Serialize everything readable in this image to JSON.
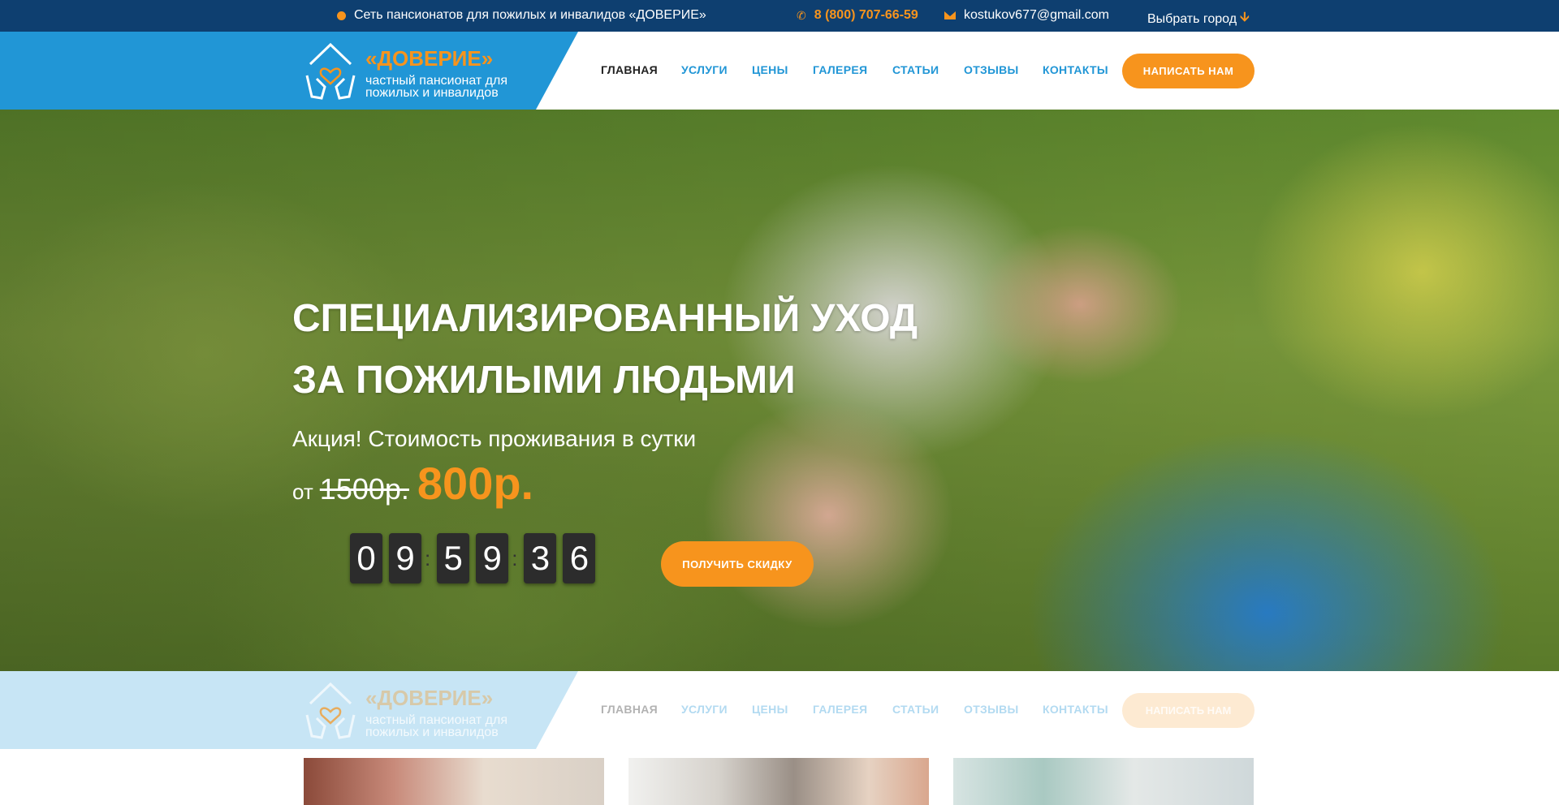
{
  "topbar": {
    "network_text": "Сеть пансионатов для пожилых и инвалидов «ДОВЕРИЕ»",
    "phone": "8 (800) 707-66-59",
    "email": "kostukov677@gmail.com",
    "city_select": "Выбрать город"
  },
  "header": {
    "logo_title": "«ДОВЕРИЕ»",
    "logo_subtitle": "частный пансионат для пожилых и инвалидов",
    "nav": [
      "ГЛАВНАЯ",
      "УСЛУГИ",
      "ЦЕНЫ",
      "ГАЛЕРЕЯ",
      "СТАТЬИ",
      "ОТЗЫВЫ",
      "КОНТАКТЫ"
    ],
    "cta": "НАПИСАТЬ НАМ"
  },
  "hero": {
    "title_line1": "СПЕЦИАЛИЗИРОВАННЫЙ УХОД",
    "title_line2": "ЗА ПОЖИЛЫМИ ЛЮДЬМИ",
    "promo": "Акция! Стоимость проживания в сутки",
    "price_from": "от",
    "price_old": "1500р.",
    "price_new": "800р.",
    "timer_digits": [
      "0",
      "9",
      "5",
      "9",
      "3",
      "6"
    ],
    "timer_separator": ":",
    "cta": "ПОЛУЧИТЬ СКИДКУ"
  },
  "colors": {
    "topbar_bg": "#0e3f70",
    "brand_blue": "#2196d6",
    "accent_orange": "#f7941d"
  },
  "icons": {
    "topbar_dot": "circle-icon",
    "phone": "phone-icon",
    "email": "envelope-icon",
    "city_arrow": "arrow-down-icon",
    "logo": "house-heart-hands-icon"
  }
}
